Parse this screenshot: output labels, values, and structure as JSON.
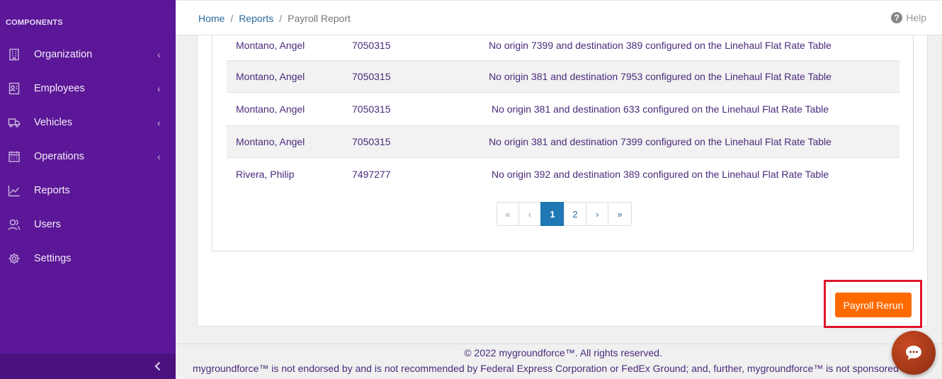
{
  "sidebar": {
    "heading": "COMPONENTS",
    "items": [
      {
        "label": "Organization",
        "icon": "building-icon",
        "has_chevron": true
      },
      {
        "label": "Employees",
        "icon": "id-card-icon",
        "has_chevron": true
      },
      {
        "label": "Vehicles",
        "icon": "truck-icon",
        "has_chevron": true
      },
      {
        "label": "Operations",
        "icon": "calendar-icon",
        "has_chevron": true
      },
      {
        "label": "Reports",
        "icon": "chart-line-icon",
        "has_chevron": false
      },
      {
        "label": "Users",
        "icon": "users-icon",
        "has_chevron": false
      },
      {
        "label": "Settings",
        "icon": "gear-icon",
        "has_chevron": false
      }
    ],
    "chevron_glyph": "‹",
    "collapse_icon": "chevron-left-icon"
  },
  "breadcrumb": {
    "home": "Home",
    "reports": "Reports",
    "current": "Payroll Report",
    "separator": "/"
  },
  "help": {
    "label": "Help",
    "icon_glyph": "?"
  },
  "table": {
    "rows": [
      {
        "name": "Montano, Angel",
        "id": "7050315",
        "message": "No origin 7399 and destination 389 configured on the Linehaul Flat Rate Table"
      },
      {
        "name": "Montano, Angel",
        "id": "7050315",
        "message": "No origin 381 and destination 7953 configured on the Linehaul Flat Rate Table"
      },
      {
        "name": "Montano, Angel",
        "id": "7050315",
        "message": "No origin 381 and destination 633 configured on the Linehaul Flat Rate Table"
      },
      {
        "name": "Montano, Angel",
        "id": "7050315",
        "message": "No origin 381 and destination 7399 configured on the Linehaul Flat Rate Table"
      },
      {
        "name": "Rivera, Philip",
        "id": "7497277",
        "message": "No origin 392 and destination 389 configured on the Linehaul Flat Rate Table"
      }
    ]
  },
  "pagination": {
    "first": "«",
    "prev": "‹",
    "pages": [
      "1",
      "2"
    ],
    "active_page": "1",
    "next": "›",
    "last": "»"
  },
  "actions": {
    "payroll_rerun": "Payroll Rerun"
  },
  "footer": {
    "copyright": "© 2022 mygroundforce™. All rights reserved.",
    "disclaimer": "mygroundforce™ is not endorsed by and is not recommended by Federal Express Corporation or FedEx Ground; and, further, mygroundforce™ is not sponsored by"
  },
  "colors": {
    "sidebar_bg": "#5b1797",
    "accent_orange": "#ff6a00",
    "highlight_red": "#e0162b",
    "active_page_blue": "#1f77b4"
  },
  "chat": {
    "icon": "chat-bubble-icon"
  }
}
